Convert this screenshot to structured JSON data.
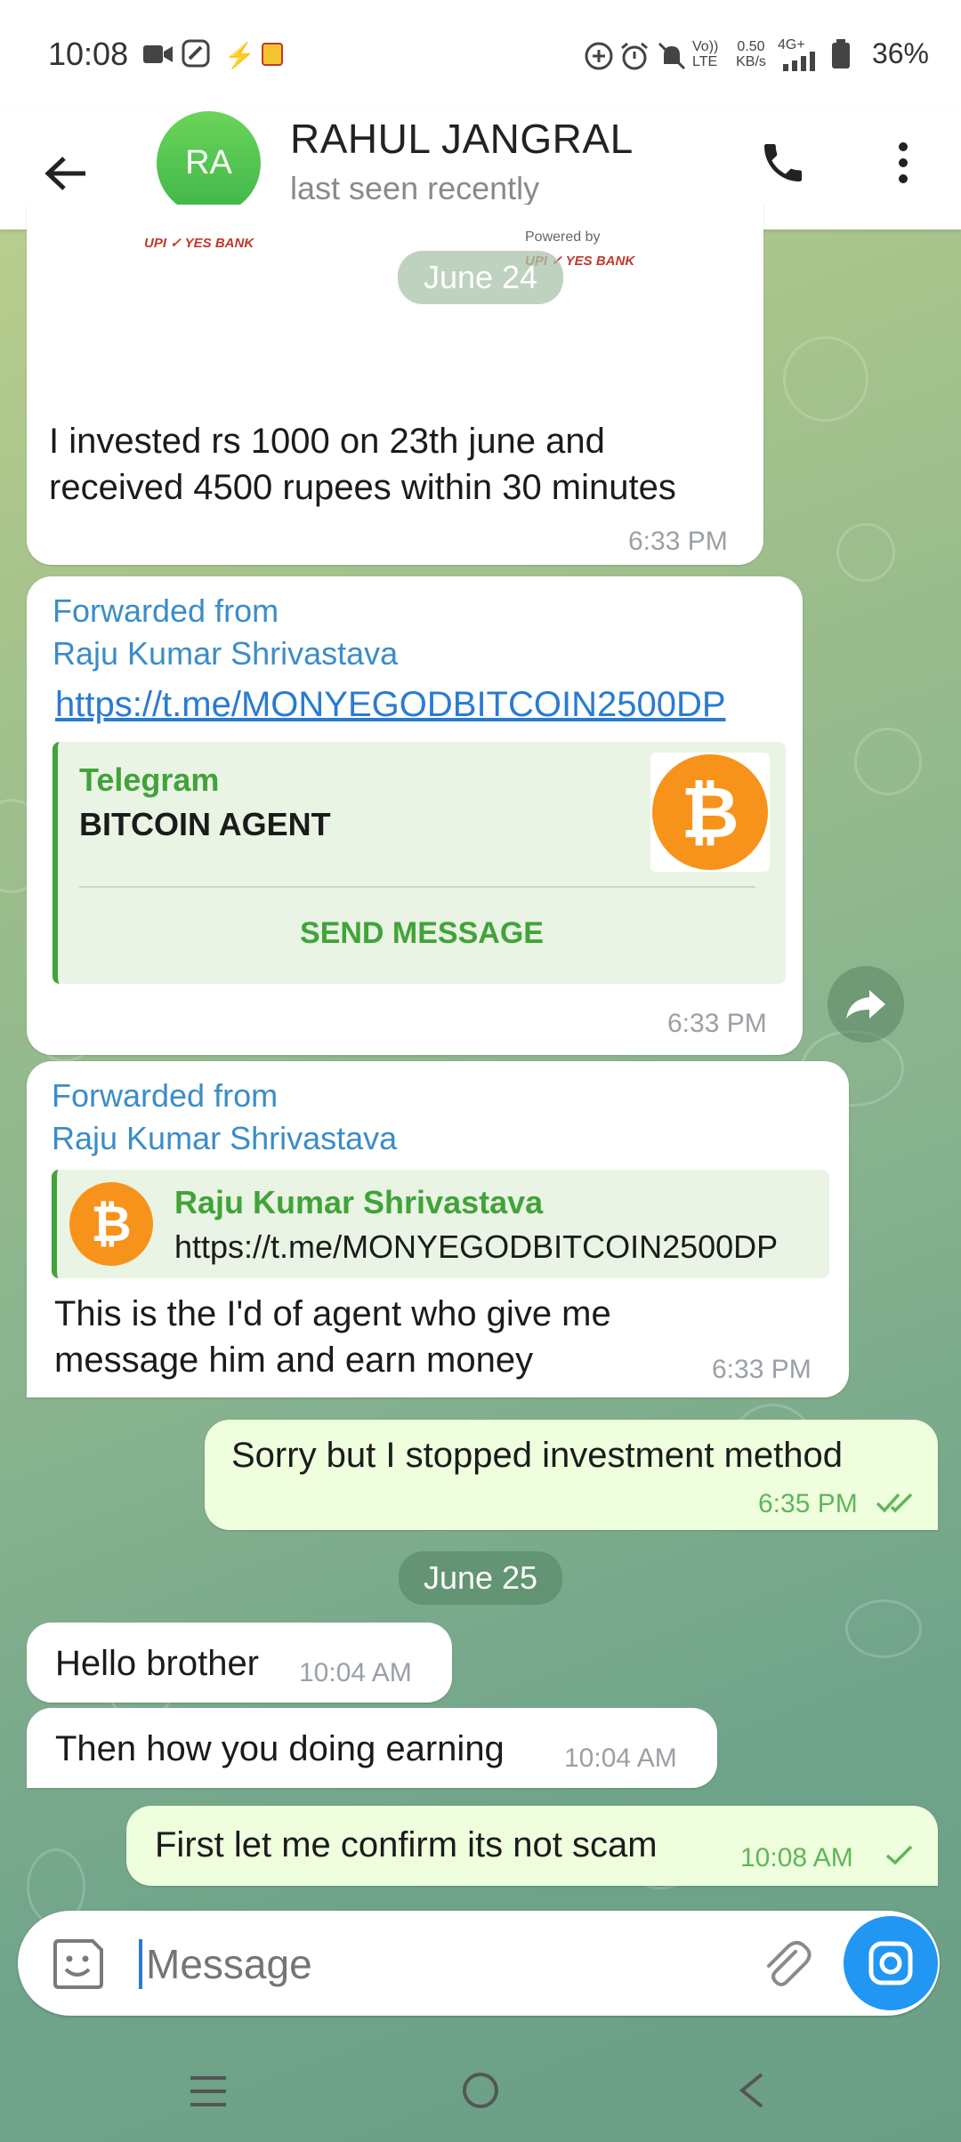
{
  "status_bar": {
    "time": "10:08",
    "network": "Vo)) LTE",
    "speed": "0.50 KB/s",
    "signal": "4G+",
    "battery": "36%"
  },
  "header": {
    "avatar_initials": "RA",
    "contact_name": "RAHUL JANGRAL",
    "contact_status": "last seen recently"
  },
  "messages": {
    "top_image_caption_1": "UPI ✓ YES BANK",
    "top_image_powered": "Powered by",
    "top_image_caption_2": "UPI ✓ YES BANK",
    "date_1": "June 24",
    "msg1_text": "I invested rs 1000 on 23th june and received 4500 rupees within 30 minutes",
    "msg1_time": "6:33 PM",
    "msg2_fwd_label": "Forwarded from",
    "msg2_fwd_name": "Raju Kumar Shrivastava",
    "msg2_link": "https://t.me/MONYEGODBITCOIN2500DP",
    "msg2_preview_site": "Telegram",
    "msg2_preview_title": "BITCOIN AGENT",
    "msg2_preview_button": "SEND MESSAGE",
    "msg2_time": "6:33 PM",
    "msg3_fwd_label": "Forwarded from",
    "msg3_fwd_name": "Raju Kumar Shrivastava",
    "msg3_preview_name": "Raju Kumar Shrivastava",
    "msg3_preview_link": "https://t.me/MONYEGODBITCOIN2500DP",
    "msg3_text": "This is the I'd of agent who give me message him and earn money",
    "msg3_time": "6:33 PM",
    "msg4_text": "Sorry but I stopped investment method",
    "msg4_time": "6:35 PM",
    "date_2": "June 25",
    "msg5_text": "Hello brother",
    "msg5_time": "10:04 AM",
    "msg6_text": "Then how you doing earning",
    "msg6_time": "10:04 AM",
    "msg7_text": "First let me confirm its not scam",
    "msg7_time": "10:08 AM"
  },
  "input": {
    "placeholder": "Message"
  },
  "icons": {
    "back": "back-arrow-icon",
    "call": "phone-icon",
    "menu": "more-vert-icon",
    "emoji": "sticker-icon",
    "attach": "paperclip-icon",
    "camera": "camera-icon",
    "share": "share-icon",
    "bitcoin": "bitcoin-logo-icon"
  },
  "colors": {
    "accent_green": "#41a33a",
    "link_blue": "#2a7bd2",
    "camera_blue": "#2196f3"
  }
}
